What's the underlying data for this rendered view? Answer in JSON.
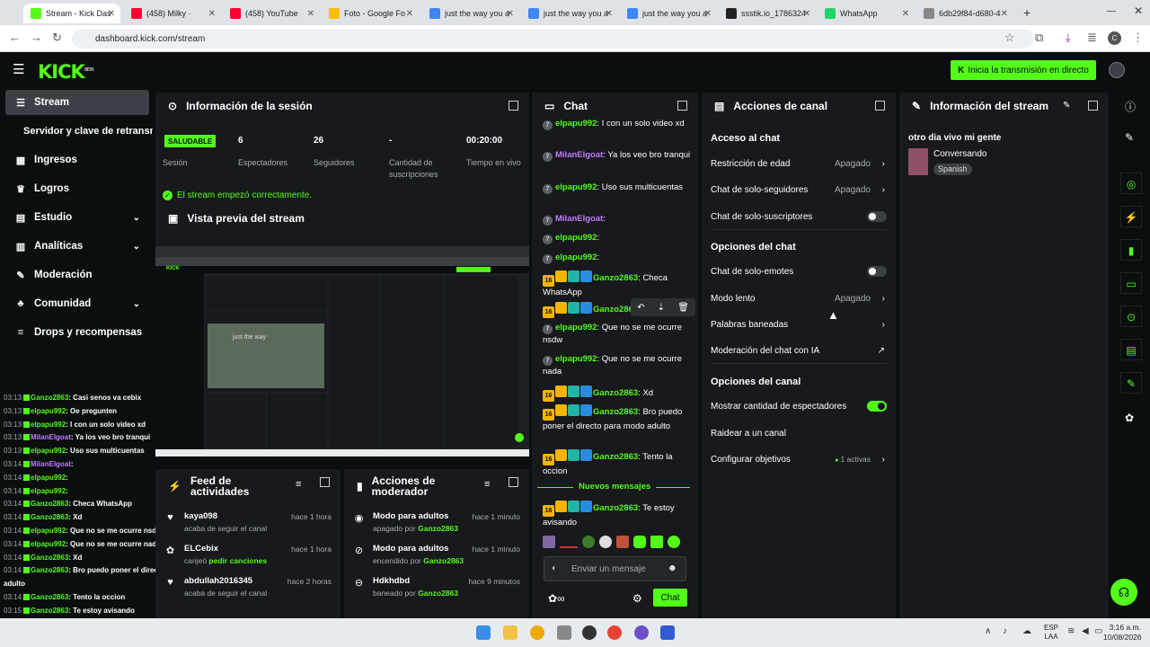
{
  "browser": {
    "tabs": [
      {
        "label": "Stream - Kick Das",
        "active": true,
        "color": "#53fc18"
      },
      {
        "label": "(458) Milky ·",
        "active": false,
        "color": "#ff0033"
      },
      {
        "label": "(458) YouTube",
        "active": false,
        "color": "#ff0033"
      },
      {
        "label": "Foto - Google Fo",
        "active": false,
        "color": "#fbbc04"
      },
      {
        "label": "just the way you a",
        "active": false,
        "color": "#4285f4"
      },
      {
        "label": "just the way you a",
        "active": false,
        "color": "#4285f4"
      },
      {
        "label": "just the way you a",
        "active": false,
        "color": "#4285f4"
      },
      {
        "label": "ssstik.io_1786324",
        "active": false,
        "color": "#222222"
      },
      {
        "label": "WhatsApp",
        "active": false,
        "color": "#25d366"
      },
      {
        "label": "6db29f84-d680-4",
        "active": false,
        "color": "#888888"
      }
    ],
    "url": "dashboard.kick.com/stream",
    "avatar_letter": "C"
  },
  "header": {
    "logo": "KICK",
    "logo_sup": "BETA",
    "go_live": "Inicia la transmisión en directo"
  },
  "sidebar": {
    "items": [
      {
        "label": "Stream",
        "icon": "stream-icon",
        "glyph": "☰",
        "active": true,
        "chevron": false
      },
      {
        "label": "Ingresos",
        "icon": "income-icon",
        "glyph": "▦",
        "active": false,
        "chevron": false
      },
      {
        "label": "Logros",
        "icon": "trophy-icon",
        "glyph": "♛",
        "active": false,
        "chevron": false
      },
      {
        "label": "Estudio",
        "icon": "studio-icon",
        "glyph": "▤",
        "active": false,
        "chevron": true
      },
      {
        "label": "Analíticas",
        "icon": "analytics-icon",
        "glyph": "▥",
        "active": false,
        "chevron": true
      },
      {
        "label": "Moderación",
        "icon": "moderation-icon",
        "glyph": "✎",
        "active": false,
        "chevron": false
      },
      {
        "label": "Comunidad",
        "icon": "community-icon",
        "glyph": "♣",
        "active": false,
        "chevron": true
      },
      {
        "label": "Drops y recompensas",
        "icon": "drops-icon",
        "glyph": "≡",
        "active": false,
        "chevron": false
      }
    ],
    "sub_item": "Servidor y clave de retransmisión"
  },
  "sidechat": [
    {
      "time": "03:13",
      "user": "Ganzo2863",
      "text": ": Casi senos va cebix",
      "purple": false
    },
    {
      "time": "03:13",
      "user": "elpapu992",
      "text": ": Oe pregunten",
      "purple": false
    },
    {
      "time": "03:13",
      "user": "elpapu992",
      "text": ": I con un solo video xd",
      "purple": false
    },
    {
      "time": "03:13",
      "user": "MilanElgoat",
      "text": ": Ya los veo bro tranqui",
      "purple": true
    },
    {
      "time": "03:13",
      "user": "elpapu992",
      "text": ": Uso sus multicuentas",
      "purple": false
    },
    {
      "time": "03:14",
      "user": "MilanElgoat",
      "text": ":",
      "purple": true
    },
    {
      "time": "03:14",
      "user": "elpapu992",
      "text": ":",
      "purple": false
    },
    {
      "time": "03:14",
      "user": "elpapu992",
      "text": ":",
      "purple": false
    },
    {
      "time": "03:14",
      "user": "Ganzo2863",
      "text": ": Checa WhatsApp",
      "purple": false
    },
    {
      "time": "03:14",
      "user": "Ganzo2863",
      "text": ": Xd",
      "purple": false
    },
    {
      "time": "03:14",
      "user": "elpapu992",
      "text": ": Que no se me ocurre nsdw",
      "purple": false
    },
    {
      "time": "03:14",
      "user": "elpapu992",
      "text": ": Que no se me ocurre nada",
      "purple": false
    },
    {
      "time": "03:14",
      "user": "Ganzo2863",
      "text": ": Xd",
      "purple": false
    },
    {
      "time": "03:14",
      "user": "Ganzo2863",
      "text": ": Bro puedo poner el directo para modo",
      "purple": false
    },
    {
      "time": "",
      "user": "",
      "text": "adulto",
      "purple": false
    },
    {
      "time": "03:14",
      "user": "Ganzo2863",
      "text": ": Tento la occion",
      "purple": false
    },
    {
      "time": "03:15",
      "user": "Ganzo2863",
      "text": ": Te estoy avisando",
      "purple": false
    }
  ],
  "session": {
    "title": "Información de la sesión",
    "status": "SALUDABLE",
    "status_label": "Sesión",
    "stats": [
      {
        "value": "6",
        "label": "Espectadores"
      },
      {
        "value": "26",
        "label": "Seguidores"
      },
      {
        "value": "-",
        "label": "Cantidad de suscripciones"
      },
      {
        "value": "00:20:00",
        "label": "Tiempo en vivo"
      }
    ],
    "ok_message": "El stream empezó correctamente."
  },
  "preview": {
    "title": "Vista previa del stream"
  },
  "feed": {
    "title": "Feed de actividades",
    "rows": [
      {
        "name": "kaya098",
        "desc_pre": "acaba de seguir el canal",
        "desc_hl": "",
        "time": "hace 1 hora",
        "icon": "heart-icon",
        "glyph": "♥"
      },
      {
        "name": "ELCebix",
        "desc_pre": "canjeó ",
        "desc_hl": "pedir canciones",
        "time": "hace 1 hora",
        "icon": "reward-icon",
        "glyph": "✿"
      },
      {
        "name": "abdullah2016345",
        "desc_pre": "acaba de seguir el canal",
        "desc_hl": "",
        "time": "hace 2 horas",
        "icon": "heart-icon",
        "glyph": "♥"
      }
    ]
  },
  "modactions": {
    "title": "Acciones de moderador",
    "rows": [
      {
        "name": "Modo para adultos",
        "desc_pre": "apagado por ",
        "desc_hl": "Ganzo2863",
        "time": "hace 1 minuto",
        "icon": "eye-icon",
        "glyph": "◉"
      },
      {
        "name": "Modo para adultos",
        "desc_pre": "encendido por ",
        "desc_hl": "Ganzo2863",
        "time": "hace 1 minuto",
        "icon": "eye-off-icon",
        "glyph": "⊘"
      },
      {
        "name": "Hdkhdbd",
        "desc_pre": "baneado por ",
        "desc_hl": "Ganzo2863",
        "time": "hace 9 minutos",
        "icon": "ban-icon",
        "glyph": "⊖"
      }
    ]
  },
  "chat": {
    "title": "Chat",
    "new_messages": "Nuevos mensajes",
    "input_placeholder": "Enviar un mensaje",
    "send_label": "Chat",
    "messages": [
      {
        "user": "elpapu992",
        "text": ": I con un solo video xd",
        "badges": "av",
        "purple": false
      },
      {
        "user": "MilanElgoat",
        "text": ": Ya los veo bro tranqui",
        "badges": "av",
        "purple": true
      },
      {
        "user": "elpapu992",
        "text": ": Uso sus multicuentas",
        "badges": "av",
        "purple": false
      },
      {
        "user": "MilanElgoat",
        "text": ":",
        "badges": "av",
        "purple": true
      },
      {
        "user": "elpapu992",
        "text": ":",
        "badges": "av",
        "purple": false
      },
      {
        "user": "elpapu992",
        "text": ":",
        "badges": "av",
        "purple": false
      },
      {
        "user": "Ganzo2863",
        "text": ": Checa WhatsApp",
        "badges": "full",
        "purple": false
      },
      {
        "user": "Ganzo2863",
        "text": "",
        "badges": "full",
        "purple": false
      },
      {
        "user": "elpapu992",
        "text": ": Que no se me ocurre nsdw",
        "badges": "av",
        "purple": false
      },
      {
        "user": "elpapu992",
        "text": ": Que no se me ocurre nada",
        "badges": "av",
        "purple": false
      },
      {
        "user": "Ganzo2863",
        "text": ": Xd",
        "badges": "full",
        "purple": false
      },
      {
        "user": "Ganzo2863",
        "text": ": Bro puedo poner el directo para modo adulto",
        "badges": "full",
        "purple": false
      },
      {
        "user": "Ganzo2863",
        "text": ": Tento la occion",
        "badges": "full",
        "purple": false
      },
      {
        "user": "Ganzo2863",
        "text": ": Te estoy avisando",
        "badges": "full",
        "purple": false
      }
    ],
    "badge_number": "16",
    "avatar_number": "7"
  },
  "channel": {
    "title": "Acciones de canal",
    "sections": [
      {
        "heading": "Acceso al chat"
      },
      {
        "heading": "Opciones del chat"
      },
      {
        "heading": "Opciones del canal"
      }
    ],
    "rows": [
      {
        "label": "Restricción de edad",
        "value": "Apagado",
        "type": "arrow"
      },
      {
        "label": "Chat de solo-seguidores",
        "value": "Apagado",
        "type": "arrow"
      },
      {
        "label": "Chat de solo-suscriptores",
        "value": "",
        "type": "toggle-off"
      },
      {
        "label": "Chat de solo-emotes",
        "value": "",
        "type": "toggle-off"
      },
      {
        "label": "Modo lento",
        "value": "Apagado",
        "type": "arrow"
      },
      {
        "label": "Palabras baneadas",
        "value": "",
        "type": "arrow"
      },
      {
        "label": "Moderación del chat con IA",
        "value": "",
        "type": "external"
      },
      {
        "label": "Mostrar cantidad de espectadores",
        "value": "",
        "type": "toggle-on"
      },
      {
        "label": "Raidear a un canal",
        "value": "",
        "type": "none"
      },
      {
        "label": "Configurar objetivos",
        "value": "1 activas",
        "type": "arrow-dot"
      }
    ]
  },
  "streaminfo": {
    "title": "Información del stream",
    "stream_title": "otro dia vivo mi gente",
    "category": "Conversando",
    "language": "Spanish"
  },
  "taskbar": {
    "lang": "ESP",
    "lang2": "LAA",
    "time": "3:16 a.m.",
    "date": "10/08/2026"
  },
  "colors": {
    "accent": "#53fc18",
    "panel": "#17191c",
    "bg": "#0b0e0f",
    "purple": "#c07cff"
  }
}
